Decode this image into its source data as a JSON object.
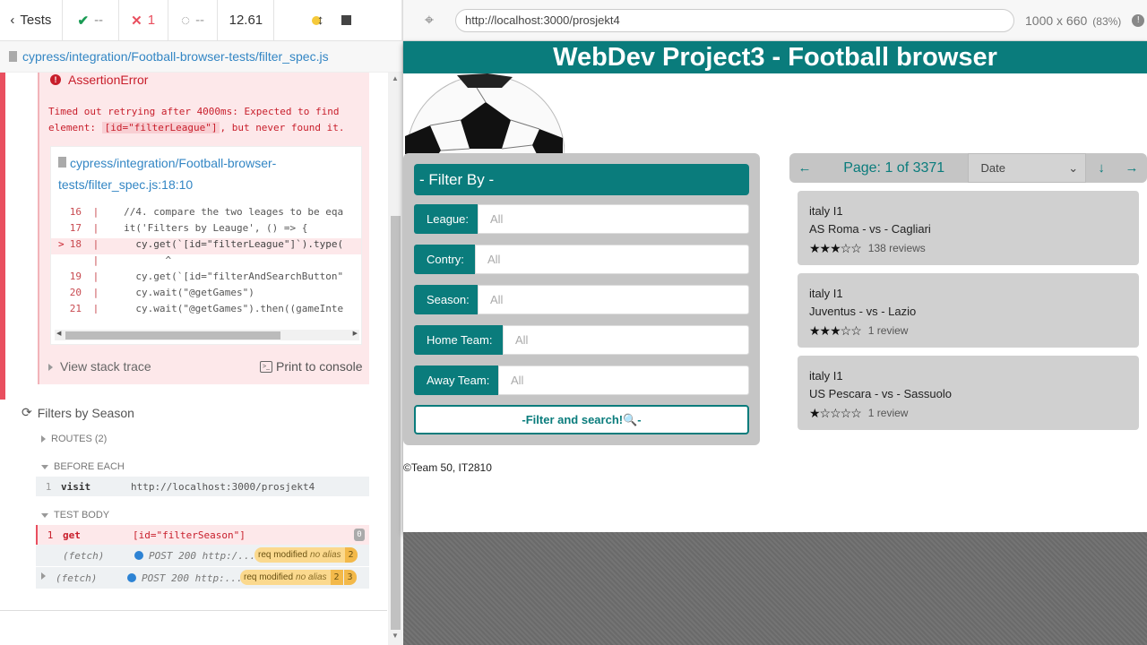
{
  "runner": {
    "tests_label": "Tests",
    "passed": "--",
    "failed": "1",
    "pending": "--",
    "duration": "12.61",
    "spec_path": "cypress/integration/Football-browser-tests/filter_spec.js",
    "error": {
      "title": "AssertionError",
      "msg_prefix": "Timed out retrying after 4000ms: Expected to find element:",
      "msg_code": "[id=\"filterLeague\"]",
      "msg_suffix": ", but never found it.",
      "frame_path": "cypress/integration/Football-browser-tests/filter_spec.js:18:10",
      "lines": [
        {
          "num": "16",
          "marker": "",
          "code": "   //4. compare the two leages to be eqa"
        },
        {
          "num": "17",
          "marker": "",
          "code": "   it('Filters by Leauge', () => {"
        },
        {
          "num": "18",
          "marker": ">",
          "code": "     cy.get(`[id=\"filterLeague\"]`).type("
        },
        {
          "num": "",
          "marker": "",
          "code": "          ^"
        },
        {
          "num": "19",
          "marker": "",
          "code": "     cy.get(`[id=\"filterAndSearchButton\""
        },
        {
          "num": "20",
          "marker": "",
          "code": "     cy.wait(\"@getGames\")"
        },
        {
          "num": "21",
          "marker": "",
          "code": "     cy.wait(\"@getGames\").then((gameInte"
        }
      ],
      "stack_label": "View stack trace",
      "print_label": "Print to console"
    },
    "test2_title": "Filters by Season",
    "routes_label": "ROUTES (2)",
    "before_each_label": "BEFORE EACH",
    "test_body_label": "TEST BODY",
    "cmd_visit": {
      "num": "1",
      "cmd": "visit",
      "arg": "http://localhost:3000/prosjekt4"
    },
    "cmd_get": {
      "num": "1",
      "cmd": "get",
      "arg": "[id=\"filterSeason\"]",
      "badge": "0"
    },
    "fetch1": {
      "label": "(fetch)",
      "text": "POST 200 http:/...",
      "pill": "req modified",
      "alias": "no alias",
      "n1": "2"
    },
    "fetch2": {
      "label": "(fetch)",
      "text": "POST 200 http:...",
      "pill": "req modified",
      "alias": "no alias",
      "n1": "2",
      "n2": "3"
    }
  },
  "browser": {
    "url": "http://localhost:3000/prosjekt4",
    "viewport": "1000 x 660",
    "zoom": "(83%)"
  },
  "app": {
    "title": "WebDev Project3 - Football browser",
    "filter_heading": "- Filter By -",
    "filters": [
      {
        "label": "League:",
        "placeholder": "All"
      },
      {
        "label": "Contry:",
        "placeholder": "All"
      },
      {
        "label": "Season:",
        "placeholder": "All"
      },
      {
        "label": "Home Team:",
        "placeholder": "All"
      },
      {
        "label": "Away Team:",
        "placeholder": "All"
      }
    ],
    "filter_button": "-Filter and search!🔍-",
    "pager": {
      "text": "Page: 1 of 3371",
      "sort_selected": "Date"
    },
    "games": [
      {
        "league": "italy I1",
        "teams": "AS Roma - vs - Cagliari",
        "stars": "★★★☆☆",
        "rating": 3,
        "reviews": "138 reviews"
      },
      {
        "league": "italy I1",
        "teams": "Juventus - vs - Lazio",
        "stars": "★★★☆☆",
        "rating": 3,
        "reviews": "1 review"
      },
      {
        "league": "italy I1",
        "teams": "US Pescara - vs - Sassuolo",
        "stars": "★☆☆☆☆",
        "rating": 1,
        "reviews": "1 review"
      }
    ],
    "footer": "©Team 50, IT2810"
  }
}
